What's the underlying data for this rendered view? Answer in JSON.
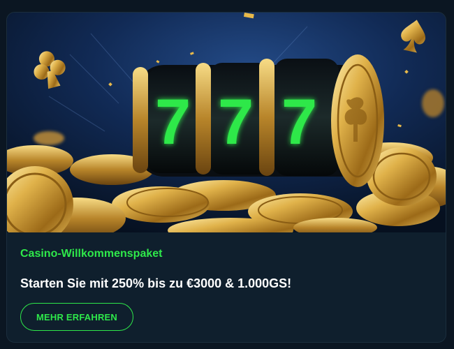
{
  "promo": {
    "subtitle": "Casino-Willkommenspaket",
    "headline": "Starten Sie mit 250% bis zu €3000 & 1.000GS!",
    "cta_label": "MEHR ERFAHREN"
  },
  "hero": {
    "reel_symbols": [
      "7",
      "7",
      "7"
    ],
    "decor": [
      "club-icon",
      "spade-icon",
      "coin-icon"
    ]
  },
  "colors": {
    "accent": "#2ee84a",
    "card_bg": "#0f1f2d",
    "page_bg": "#0b1622",
    "text": "#ffffff"
  }
}
